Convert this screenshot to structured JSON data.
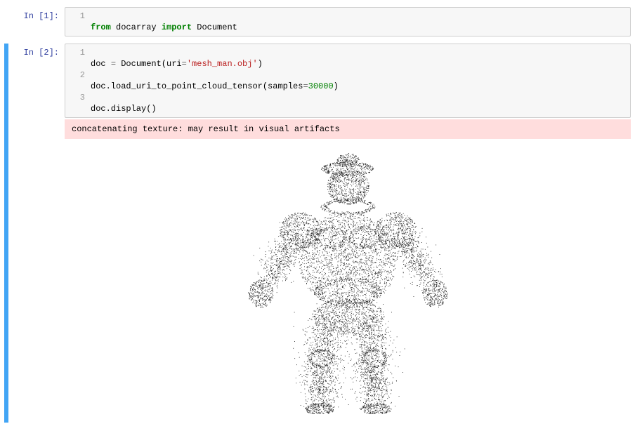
{
  "cells": [
    {
      "prompt": "In [1]:",
      "lines": [
        {
          "n": "1",
          "tokens": [
            {
              "t": "from ",
              "c": "kw"
            },
            {
              "t": "docarray ",
              "c": "nm"
            },
            {
              "t": "import ",
              "c": "kw"
            },
            {
              "t": "Document",
              "c": "nm"
            }
          ]
        }
      ]
    },
    {
      "prompt": "In [2]:",
      "lines": [
        {
          "n": "1",
          "tokens": [
            {
              "t": "doc ",
              "c": "nm"
            },
            {
              "t": "= ",
              "c": "op"
            },
            {
              "t": "Document(uri",
              "c": "nm"
            },
            {
              "t": "=",
              "c": "op"
            },
            {
              "t": "'mesh_man.obj'",
              "c": "str"
            },
            {
              "t": ")",
              "c": "nm"
            }
          ]
        },
        {
          "n": "2",
          "tokens": [
            {
              "t": "doc.load_uri_to_point_cloud_tensor(samples",
              "c": "nm"
            },
            {
              "t": "=",
              "c": "op"
            },
            {
              "t": "30000",
              "c": "num"
            },
            {
              "t": ")",
              "c": "nm"
            }
          ]
        },
        {
          "n": "3",
          "tokens": [
            {
              "t": "doc.display()",
              "c": "nm"
            }
          ]
        }
      ],
      "stderr": "concatenating texture: may result in visual artifacts",
      "has_display": true
    }
  ]
}
